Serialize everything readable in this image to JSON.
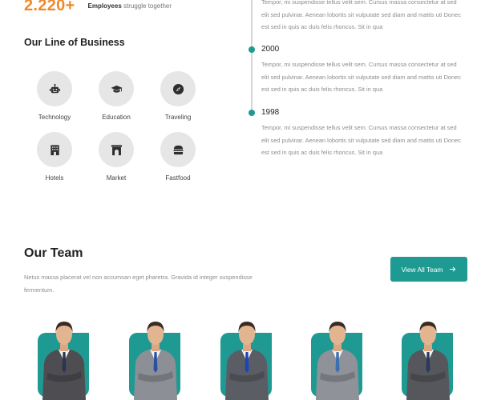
{
  "stat": {
    "number": "2.220+",
    "label_bold": "Employees",
    "label_rest": " struggle together"
  },
  "line_of_business": {
    "title": "Our Line of Business",
    "items": [
      {
        "label": "Technology",
        "icon": "robot-icon"
      },
      {
        "label": "Education",
        "icon": "graduation-cap-icon"
      },
      {
        "label": "Traveling",
        "icon": "compass-icon"
      },
      {
        "label": "Hotels",
        "icon": "hotel-icon"
      },
      {
        "label": "Market",
        "icon": "archway-icon"
      },
      {
        "label": "Fastfood",
        "icon": "hamburger-icon"
      }
    ]
  },
  "timeline": {
    "entries": [
      {
        "year": "",
        "text": "Tempor, mi suspendisse tellus velit sem. Cursus massa consectetur at sed elit sed pulvinar. Aenean lobortis sit vulputate sed diam and mattis uti Donec est sed in quis ac duis felis rhoncus. Sit in qua"
      },
      {
        "year": "2000",
        "text": "Tempor, mi suspendisse tellus velit sem. Cursus massa consectetur at sed elit sed pulvinar. Aenean lobortis sit vulputate sed diam and mattis uti Donec est sed in quis ac duis felis rhoncus. Sit in qua"
      },
      {
        "year": "1998",
        "text": "Tempor, mi suspendisse tellus velit sem. Cursus massa consectetur at sed elit sed pulvinar. Aenean lobortis sit vulputate sed diam and mattis uti Donec est sed in quis ac duis felis rhoncus. Sit in qua"
      }
    ]
  },
  "team": {
    "title": "Our Team",
    "description": "Netus massa placerat vel non accumsan eget pharetra. Gravida id integer suspendisse fermentum.",
    "button_label": "View All Team",
    "members": [
      {
        "suit": "#4e4e52",
        "tie": "#2a3550"
      },
      {
        "suit": "#8c8f95",
        "tie": "#2c4fa3"
      },
      {
        "suit": "#5a5d63",
        "tie": "#1d44b8"
      },
      {
        "suit": "#8f9298",
        "tie": "#3a6fb0"
      },
      {
        "suit": "#55575c",
        "tie": "#2a3a5e"
      }
    ]
  },
  "colors": {
    "accent": "#1e9a92",
    "stat_orange": "#f0892c",
    "icon_circle": "#e6e6e6"
  }
}
